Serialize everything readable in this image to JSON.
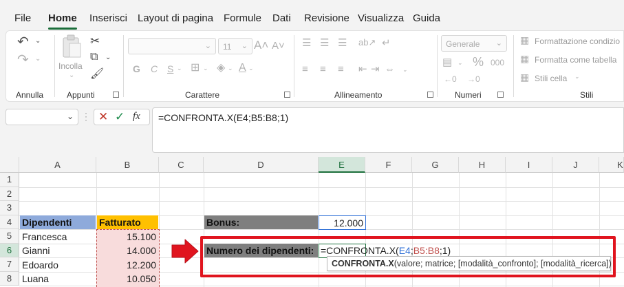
{
  "menu": {
    "items": [
      "File",
      "Home",
      "Inserisci",
      "Layout di pagina",
      "Formule",
      "Dati",
      "Revisione",
      "Visualizza",
      "Guida"
    ],
    "active": "Home"
  },
  "ribbon": {
    "undo_group": "Annulla",
    "clipboard": {
      "label": "Appunti",
      "paste": "Incolla"
    },
    "font": {
      "label": "Carattere",
      "size": "11",
      "bold": "G",
      "italic": "C",
      "underline": "S"
    },
    "alignment": {
      "label": "Allineamento"
    },
    "number": {
      "label": "Numeri",
      "format": "Generale",
      "percent": "%",
      "thousands": "000"
    },
    "styles": {
      "label": "Stili",
      "conditional": "Formattazione condizio",
      "as_table": "Formatta come tabella",
      "cell_styles": "Stili cella"
    }
  },
  "formula_bar": {
    "fx": "fx",
    "formula": "=CONFRONTA.X(E4;B5:B8;1)"
  },
  "columns": [
    "A",
    "B",
    "C",
    "D",
    "E",
    "F",
    "G",
    "H",
    "I",
    "J",
    "K"
  ],
  "rows": [
    "1",
    "2",
    "3",
    "4",
    "5",
    "6",
    "7",
    "8"
  ],
  "cells": {
    "a4": "Dipendenti",
    "b4": "Fatturato",
    "a5": "Francesca",
    "b5": "15.100",
    "a6": "Gianni",
    "b6": "14.000",
    "a7": "Edoardo",
    "b7": "12.200",
    "a8": "Luana",
    "b8": "10.050",
    "d4": "Bonus:",
    "e4": "12.000",
    "d6": "Numero dei dipendenti:"
  },
  "edit": {
    "fn": "=CONFRONTA.X(",
    "arg1": "E4",
    "sep1": ";",
    "arg2": "B5:B8",
    "tail": ";1)"
  },
  "tooltip": {
    "fn": "CONFRONTA.X",
    "args": "(valore; matrice; [modalità_confronto]; [modalità_ricerca])"
  },
  "colors": {
    "header_blue": "#8eaadb",
    "header_orange": "#ffc000",
    "grey_label": "#7f7f7f",
    "highlight_red": "#e0141e",
    "range_blue": "#2f6fd6",
    "range_red": "#c0504d",
    "excel_green": "#1b6e3a"
  }
}
